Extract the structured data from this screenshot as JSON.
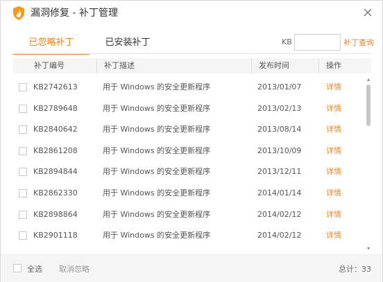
{
  "window": {
    "title": "漏洞修复 - 补丁管理",
    "accent_color": "#f0831e",
    "icon": "shield-fire-icon"
  },
  "tabs": [
    {
      "label": "已忽略补丁",
      "active": true
    },
    {
      "label": "已安装补丁",
      "active": false
    }
  ],
  "search": {
    "prefix": "KB",
    "value": "",
    "placeholder": "",
    "button_label": "补丁查询"
  },
  "table": {
    "headers": [
      "补丁编号",
      "补丁描述",
      "发布时间",
      "操作"
    ],
    "rows": [
      {
        "id": "KB2742613",
        "desc": "用于 Windows 的安全更新程序",
        "date": "2013/01/07",
        "action": "详情"
      },
      {
        "id": "KB2789648",
        "desc": "用于 Windows 的安全更新程序",
        "date": "2013/02/13",
        "action": "详情"
      },
      {
        "id": "KB2840642",
        "desc": "用于 Windows 的安全更新程序",
        "date": "2013/08/14",
        "action": "详情"
      },
      {
        "id": "KB2861208",
        "desc": "用于 Windows 的安全更新程序",
        "date": "2013/10/09",
        "action": "详情"
      },
      {
        "id": "KB2894844",
        "desc": "用于 Windows 的安全更新程序",
        "date": "2013/12/11",
        "action": "详情"
      },
      {
        "id": "KB2862330",
        "desc": "用于 Windows 的安全更新程序",
        "date": "2014/01/14",
        "action": "详情"
      },
      {
        "id": "KB2898864",
        "desc": "用于 Windows 的安全更新程序",
        "date": "2014/02/12",
        "action": "详情"
      },
      {
        "id": "KB2901118",
        "desc": "用于 Windows 的安全更新程序",
        "date": "2014/02/12",
        "action": "详情"
      }
    ]
  },
  "footer": {
    "select_all_label": "全选",
    "cancel_ignore_label": "取消忽略",
    "total_label": "总计：33"
  }
}
